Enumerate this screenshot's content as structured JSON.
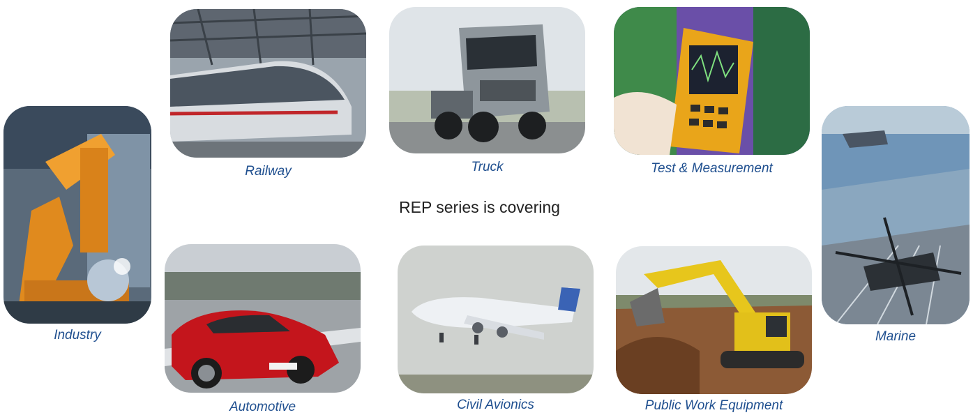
{
  "headline": "REP series is covering",
  "sectors": {
    "railway": "Railway",
    "truck": "Truck",
    "test": "Test & Measurement",
    "industry": "Industry",
    "automotive": "Automotive",
    "avionics": "Civil Avionics",
    "public_work": "Public Work Equipment",
    "marine": "Marine"
  },
  "colors": {
    "caption": "#1f4f8f",
    "headline": "#222222"
  }
}
